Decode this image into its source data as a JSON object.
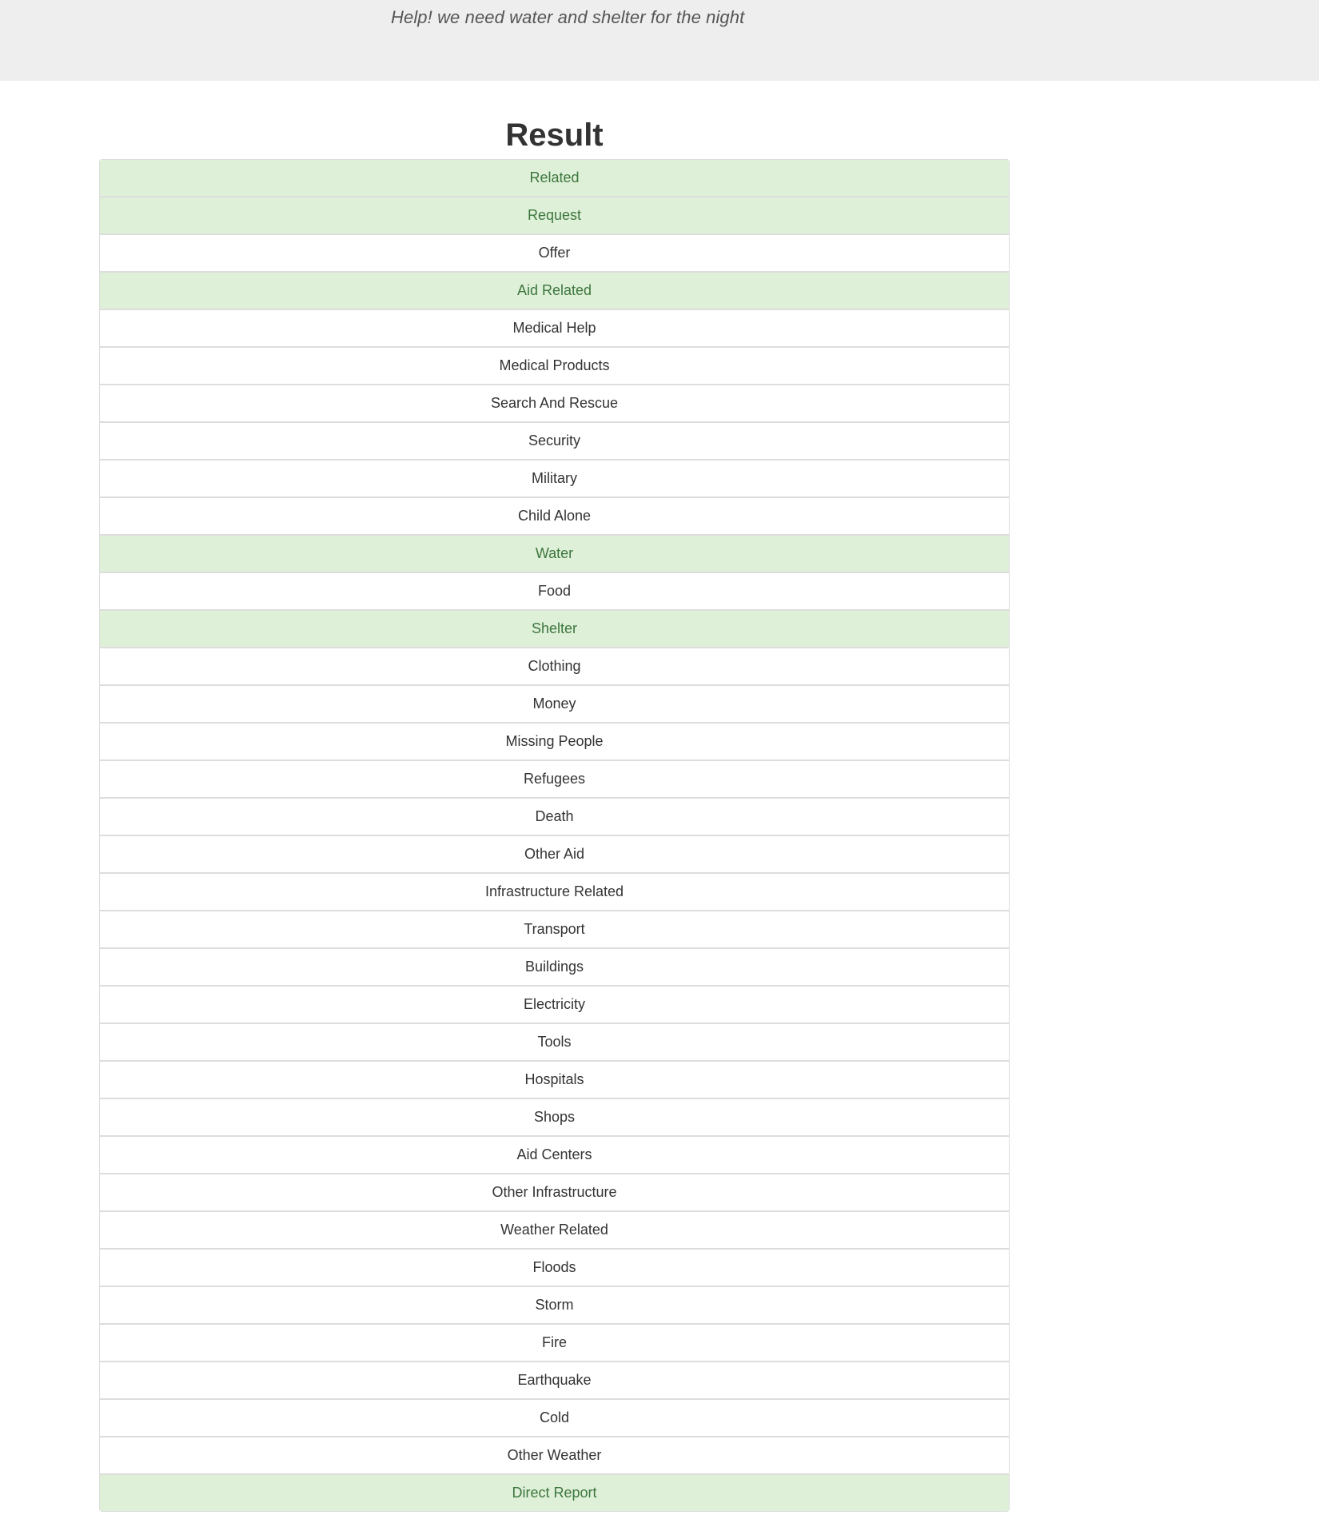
{
  "hero": {
    "message": "Help! we need water and shelter for the night"
  },
  "result": {
    "title": "Result",
    "categories": [
      {
        "label": "Related",
        "positive": true
      },
      {
        "label": "Request",
        "positive": true
      },
      {
        "label": "Offer",
        "positive": false
      },
      {
        "label": "Aid Related",
        "positive": true
      },
      {
        "label": "Medical Help",
        "positive": false
      },
      {
        "label": "Medical Products",
        "positive": false
      },
      {
        "label": "Search And Rescue",
        "positive": false
      },
      {
        "label": "Security",
        "positive": false
      },
      {
        "label": "Military",
        "positive": false
      },
      {
        "label": "Child Alone",
        "positive": false
      },
      {
        "label": "Water",
        "positive": true
      },
      {
        "label": "Food",
        "positive": false
      },
      {
        "label": "Shelter",
        "positive": true
      },
      {
        "label": "Clothing",
        "positive": false
      },
      {
        "label": "Money",
        "positive": false
      },
      {
        "label": "Missing People",
        "positive": false
      },
      {
        "label": "Refugees",
        "positive": false
      },
      {
        "label": "Death",
        "positive": false
      },
      {
        "label": "Other Aid",
        "positive": false
      },
      {
        "label": "Infrastructure Related",
        "positive": false
      },
      {
        "label": "Transport",
        "positive": false
      },
      {
        "label": "Buildings",
        "positive": false
      },
      {
        "label": "Electricity",
        "positive": false
      },
      {
        "label": "Tools",
        "positive": false
      },
      {
        "label": "Hospitals",
        "positive": false
      },
      {
        "label": "Shops",
        "positive": false
      },
      {
        "label": "Aid Centers",
        "positive": false
      },
      {
        "label": "Other Infrastructure",
        "positive": false
      },
      {
        "label": "Weather Related",
        "positive": false
      },
      {
        "label": "Floods",
        "positive": false
      },
      {
        "label": "Storm",
        "positive": false
      },
      {
        "label": "Fire",
        "positive": false
      },
      {
        "label": "Earthquake",
        "positive": false
      },
      {
        "label": "Cold",
        "positive": false
      },
      {
        "label": "Other Weather",
        "positive": false
      },
      {
        "label": "Direct Report",
        "positive": true
      }
    ]
  },
  "colors": {
    "hero_background": "#eeeeee",
    "positive_background": "#dff0d8",
    "positive_text": "#3c763d",
    "neutral_text": "#333333",
    "border": "#dddddd"
  }
}
